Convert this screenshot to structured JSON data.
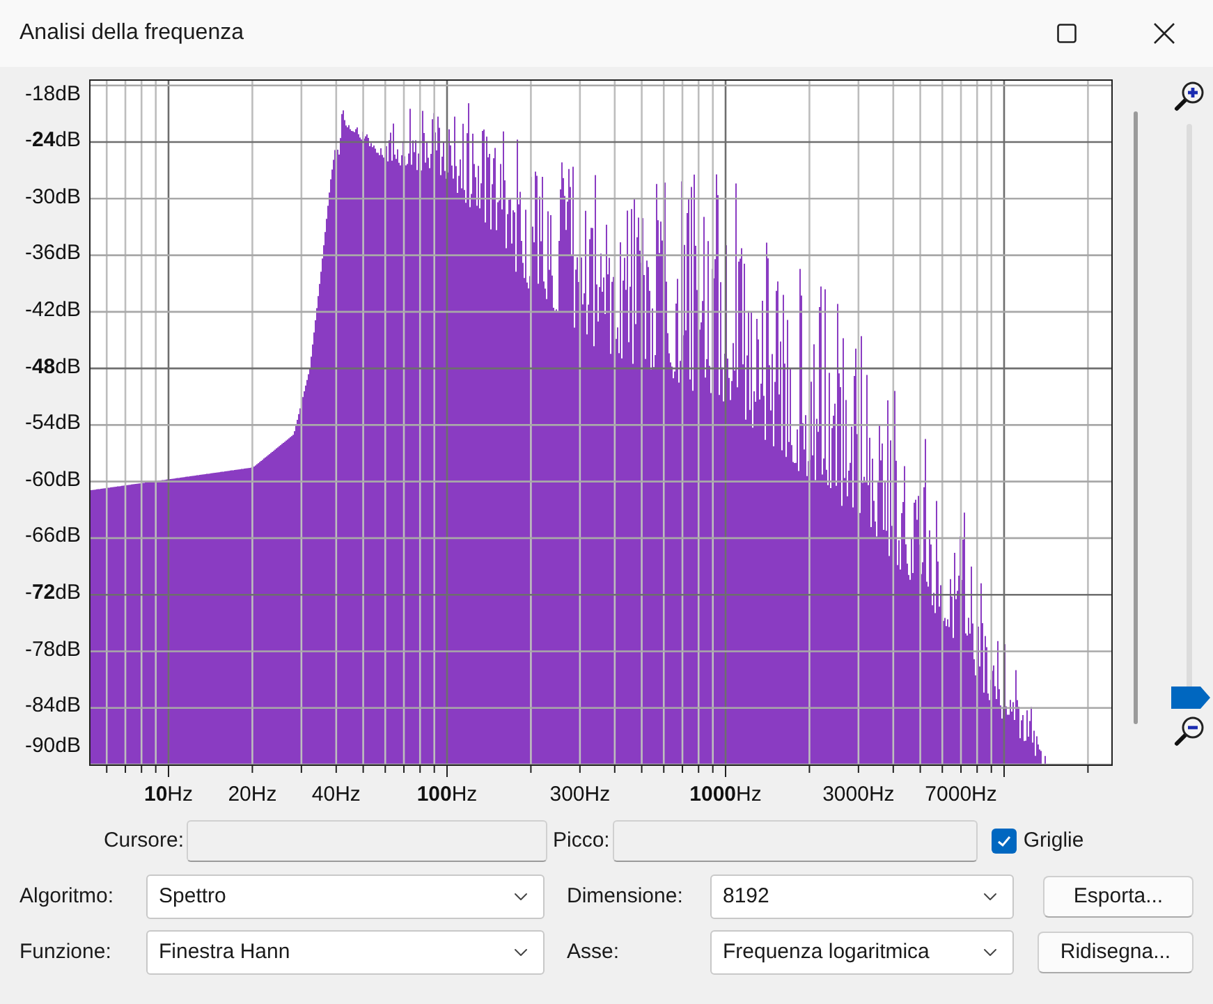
{
  "window": {
    "title": "Analisi della frequenza"
  },
  "plot": {
    "y_labels": [
      "-18dB",
      "-**24**dB",
      "-30dB",
      "-36dB",
      "-42dB",
      "-**48**dB",
      "-54dB",
      "-60dB",
      "-66dB",
      "-**72**dB",
      "-78dB",
      "-84dB",
      "-90dB"
    ],
    "x_labels": [
      "**10**Hz",
      "20Hz",
      "40Hz",
      "**100**Hz",
      "300Hz",
      "**1000**Hz",
      "3000Hz",
      "7000Hz"
    ]
  },
  "zoom_slider": {
    "level": 0
  },
  "cursor": {
    "label": "Cursore:"
  },
  "peak": {
    "label": "Picco:"
  },
  "grids": {
    "label": "Griglie",
    "checked": true
  },
  "algorithm": {
    "label": "Algoritmo:",
    "value": "Spettro"
  },
  "size": {
    "label": "Dimensione:",
    "value": "8192"
  },
  "function": {
    "label": "Funzione:",
    "value": "Finestra Hann"
  },
  "axis": {
    "label": "Asse:",
    "value": "Frequenza logaritmica"
  },
  "buttons": [
    "Esporta...",
    "Ridisegna..."
  ]
}
